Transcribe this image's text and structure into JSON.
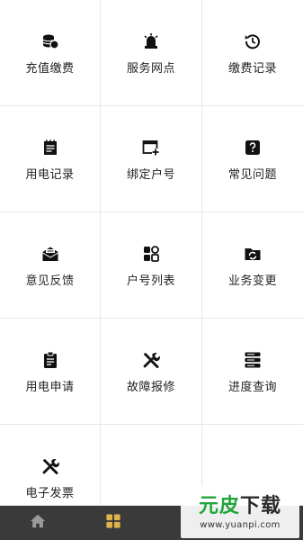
{
  "menu": {
    "items": [
      {
        "label": "充值缴费",
        "icon": "coins-database-icon"
      },
      {
        "label": "服务网点",
        "icon": "siren-light-icon"
      },
      {
        "label": "缴费记录",
        "icon": "history-clock-icon"
      },
      {
        "label": "用电记录",
        "icon": "notepad-icon"
      },
      {
        "label": "绑定户号",
        "icon": "window-add-icon"
      },
      {
        "label": "常见问题",
        "icon": "help-question-icon"
      },
      {
        "label": "意见反馈",
        "icon": "mail-open-icon"
      },
      {
        "label": "户号列表",
        "icon": "apps-grid-icon"
      },
      {
        "label": "业务变更",
        "icon": "folder-sync-icon"
      },
      {
        "label": "用电申请",
        "icon": "clipboard-icon"
      },
      {
        "label": "故障报修",
        "icon": "tools-icon"
      },
      {
        "label": "进度查询",
        "icon": "server-list-icon"
      },
      {
        "label": "电子发票",
        "icon": "tools-icon"
      }
    ]
  },
  "tabbar": {
    "tabs": [
      {
        "icon": "home-icon",
        "active": false
      },
      {
        "icon": "grid-menu-icon",
        "active": true
      }
    ],
    "active_color": "#e0b24a",
    "inactive_color": "#9a9a9a"
  },
  "watermark": {
    "logo_green": "元",
    "logo_dark": "",
    "logo_green_2": "皮",
    "logo_dark_2": "下载",
    "url": "www.yuanpi.com"
  }
}
